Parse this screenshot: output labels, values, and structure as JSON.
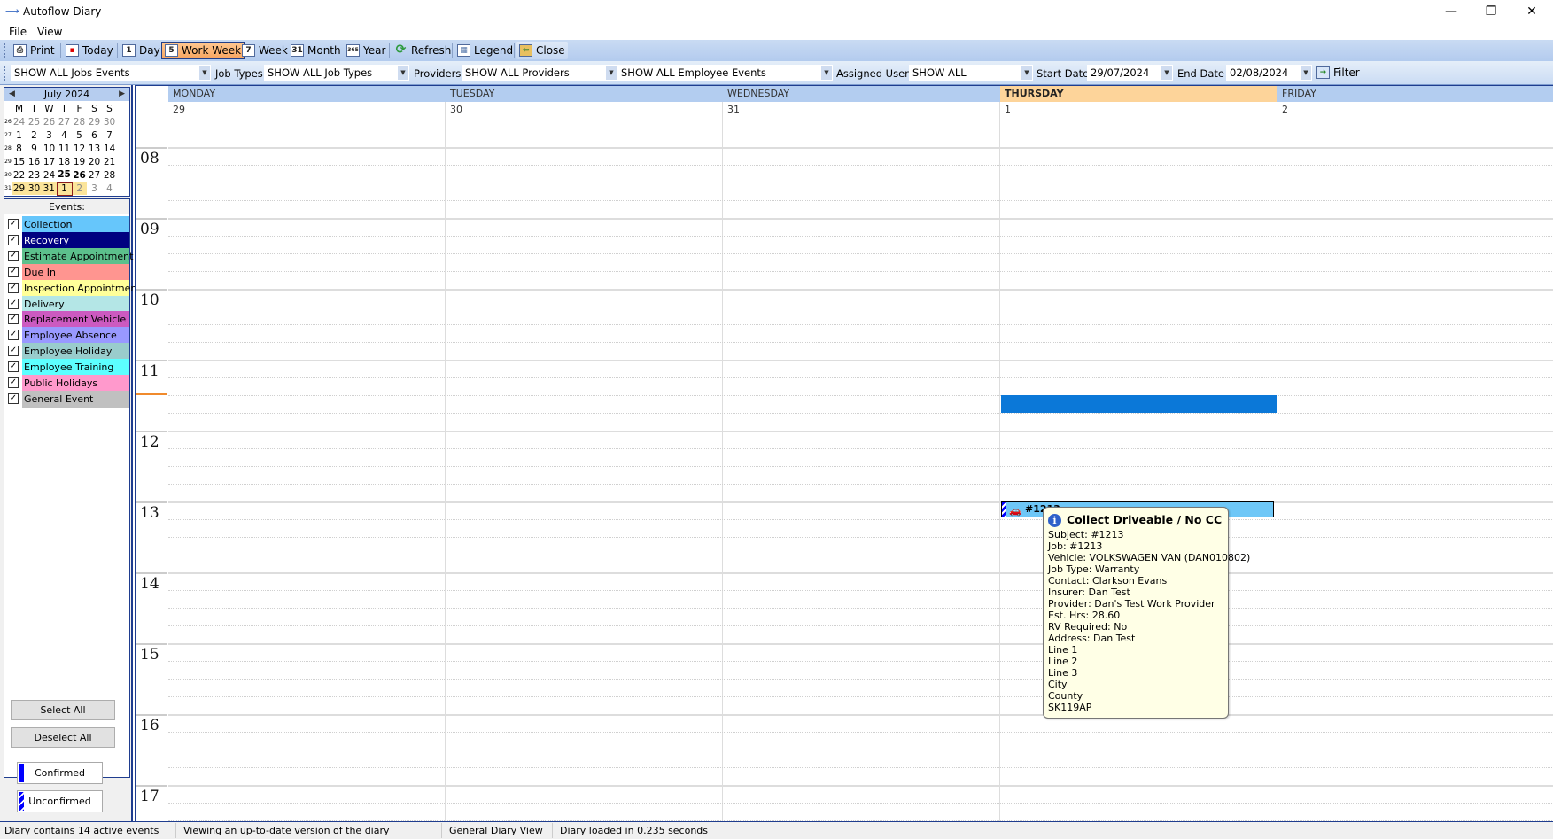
{
  "window": {
    "title": "Autoflow Diary",
    "minimize": "—",
    "restore": "❐",
    "close": "✕"
  },
  "menu": [
    "File",
    "View"
  ],
  "toolbar": {
    "items": [
      {
        "label": "Print",
        "icon": "printer-icon",
        "glyph": "⎙"
      },
      {
        "label": "Today",
        "icon": "today-icon",
        "glyph": "▪"
      },
      {
        "label": "Day",
        "icon": "day-icon",
        "glyph": "1"
      },
      {
        "label": "Work Week",
        "icon": "work-week-icon",
        "glyph": "5",
        "active": true
      },
      {
        "label": "Week",
        "icon": "week-icon",
        "glyph": "7"
      },
      {
        "label": "Month",
        "icon": "month-icon",
        "glyph": "31"
      },
      {
        "label": "Year",
        "icon": "year-icon",
        "glyph": "365"
      },
      {
        "label": "Refresh",
        "icon": "refresh-icon",
        "glyph": "⟳"
      },
      {
        "label": "Legend",
        "icon": "legend-icon",
        "glyph": "▦"
      },
      {
        "label": "Close",
        "icon": "exit-door-icon",
        "glyph": "⇦"
      }
    ]
  },
  "filters": {
    "jobs_events": "SHOW ALL Jobs Events",
    "job_types_label": "Job Types",
    "job_types": "SHOW ALL Job Types",
    "providers_label": "Providers",
    "providers": "SHOW ALL Providers",
    "employee_events": "SHOW ALL Employee Events",
    "assigned_user_label": "Assigned User:",
    "assigned_user": "SHOW ALL",
    "start_date_label": "Start Date",
    "start_date": "29/07/2024",
    "end_date_label": "End Date",
    "end_date": "02/08/2024",
    "filter_label": "Filter"
  },
  "mini_calendar": {
    "month": "July 2024",
    "weekdays": [
      "M",
      "T",
      "W",
      "T",
      "F",
      "S",
      "S"
    ],
    "weeks": [
      {
        "wk": "26",
        "days": [
          "24",
          "25",
          "26",
          "27",
          "28",
          "29",
          "30"
        ],
        "grey": [
          0,
          1,
          2,
          3,
          4,
          5,
          6
        ]
      },
      {
        "wk": "27",
        "days": [
          "1",
          "2",
          "3",
          "4",
          "5",
          "6",
          "7"
        ]
      },
      {
        "wk": "28",
        "days": [
          "8",
          "9",
          "10",
          "11",
          "12",
          "13",
          "14"
        ]
      },
      {
        "wk": "29",
        "days": [
          "15",
          "16",
          "17",
          "18",
          "19",
          "20",
          "21"
        ]
      },
      {
        "wk": "30",
        "days": [
          "22",
          "23",
          "24",
          "25",
          "26",
          "27",
          "28"
        ],
        "bold": [
          3,
          4
        ]
      },
      {
        "wk": "31",
        "days": [
          "29",
          "30",
          "31",
          "1",
          "2",
          "3",
          "4"
        ],
        "grey": [
          4,
          5,
          6
        ],
        "selected": [
          0,
          1,
          2,
          3,
          4
        ],
        "today": 3
      }
    ]
  },
  "events_panel": {
    "title": "Events:",
    "items": [
      {
        "label": "Collection",
        "color": "#66c6fb",
        "text": "#000000",
        "checked": true
      },
      {
        "label": "Recovery",
        "color": "#000080",
        "text": "#ffffff",
        "checked": true
      },
      {
        "label": "Estimate Appointment",
        "color": "#5cc08c",
        "text": "#000000",
        "checked": true
      },
      {
        "label": "Due In",
        "color": "#ff9590",
        "text": "#000000",
        "checked": true
      },
      {
        "label": "Inspection Appointment",
        "color": "#ffff99",
        "text": "#000000",
        "checked": true
      },
      {
        "label": "Delivery",
        "color": "#b4e6e6",
        "text": "#000000",
        "checked": true
      },
      {
        "label": "Replacement Vehicle",
        "color": "#cc5ac0",
        "text": "#000000",
        "checked": true
      },
      {
        "label": "Employee Absence",
        "color": "#9999ff",
        "text": "#000000",
        "checked": true
      },
      {
        "label": "Employee Holiday",
        "color": "#99cccc",
        "text": "#000000",
        "checked": true
      },
      {
        "label": "Employee Training",
        "color": "#5cffff",
        "text": "#000000",
        "checked": true
      },
      {
        "label": "Public Holidays",
        "color": "#ff99cc",
        "text": "#000000",
        "checked": true
      },
      {
        "label": "General Event",
        "color": "#c0c0c0",
        "text": "#000000",
        "checked": true
      }
    ],
    "select_all": "Select All",
    "deselect_all": "Deselect All",
    "legend_confirmed": "Confirmed",
    "legend_unconfirmed": "Unconfirmed"
  },
  "diary": {
    "days": [
      {
        "name": "MONDAY",
        "date": "29"
      },
      {
        "name": "TUESDAY",
        "date": "30"
      },
      {
        "name": "WEDNESDAY",
        "date": "31"
      },
      {
        "name": "THURSDAY",
        "date": "1",
        "today": true
      },
      {
        "name": "FRIDAY",
        "date": "2"
      }
    ],
    "hours": [
      "08",
      "09",
      "10",
      "11",
      "12",
      "13",
      "14",
      "15",
      "16",
      "17"
    ],
    "event": {
      "label": "#1213"
    },
    "tooltip": {
      "title": "Collect Driveable / No CC",
      "lines": [
        "Subject: #1213",
        "Job: #1213",
        "Vehicle: VOLKSWAGEN VAN (DAN010802)",
        "Job Type: Warranty",
        "Contact: Clarkson Evans",
        "Insurer: Dan Test",
        "Provider: Dan's Test Work Provider",
        "Est. Hrs: 28.60",
        "RV Required: No",
        "Address: Dan Test",
        "Line 1",
        "Line 2",
        "Line 3",
        "City",
        "County",
        "SK119AP"
      ]
    }
  },
  "status": {
    "events": "Diary contains 14 active events",
    "version": "Viewing an up-to-date version of the diary",
    "view": "General Diary View",
    "load": "Diary loaded in 0.235 seconds"
  }
}
